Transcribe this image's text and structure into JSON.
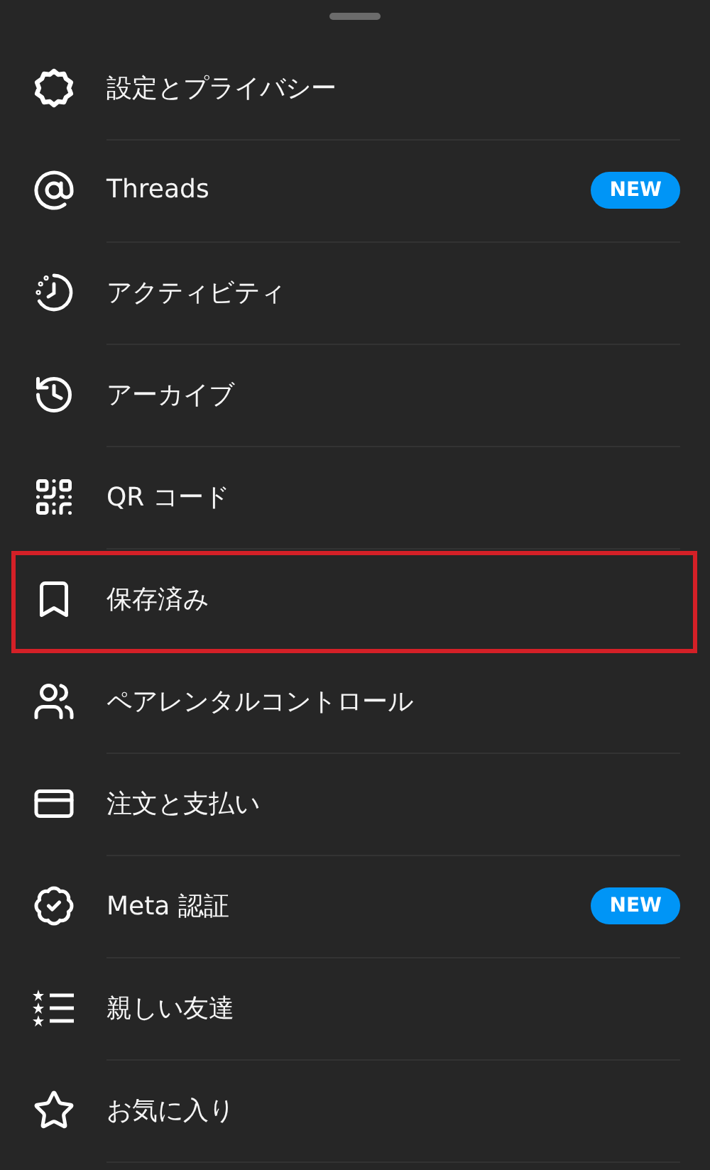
{
  "menu": {
    "items": [
      {
        "label": "設定とプライバシー",
        "highlighted": false
      },
      {
        "label": "Threads",
        "badge": "NEW",
        "highlighted": false
      },
      {
        "label": "アクティビティ",
        "highlighted": false
      },
      {
        "label": "アーカイブ",
        "highlighted": false
      },
      {
        "label": "QR コード",
        "highlighted": false
      },
      {
        "label": "保存済み",
        "highlighted": true
      },
      {
        "label": "ペアレンタルコントロール",
        "highlighted": false
      },
      {
        "label": "注文と支払い",
        "highlighted": false
      },
      {
        "label": "Meta 認証",
        "badge": "NEW",
        "highlighted": false
      },
      {
        "label": "親しい友達",
        "highlighted": false
      },
      {
        "label": "お気に入り",
        "highlighted": false
      }
    ]
  }
}
